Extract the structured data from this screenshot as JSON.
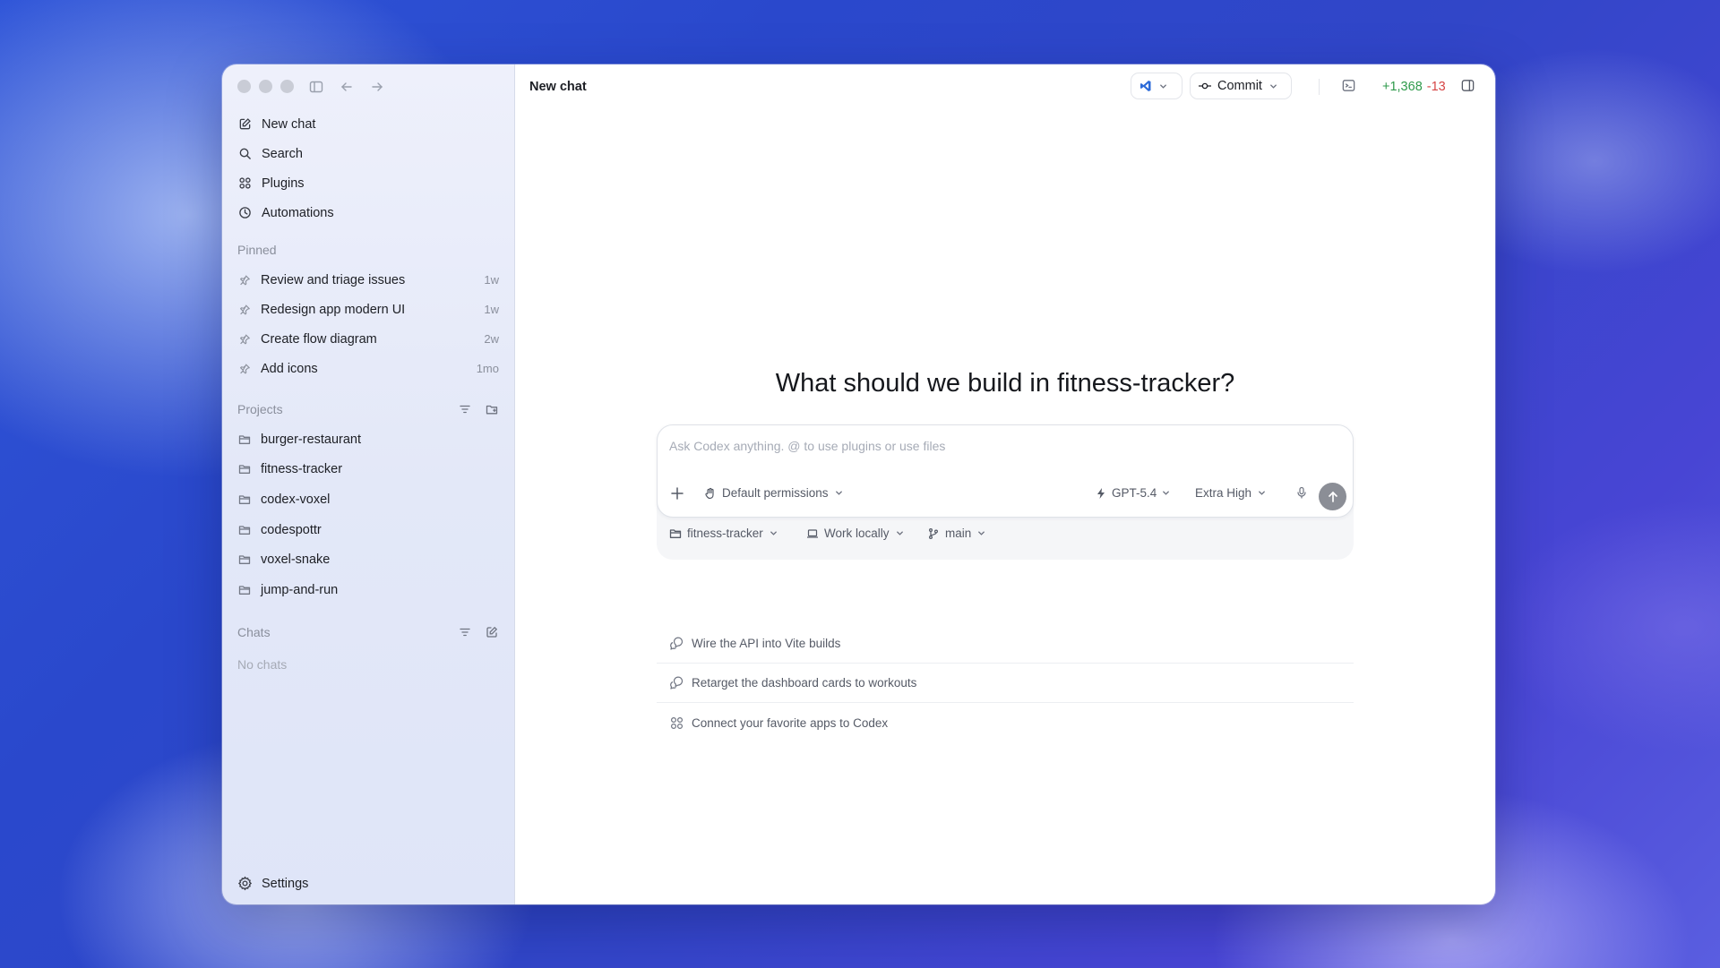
{
  "window": {
    "title": "New chat"
  },
  "sidebar": {
    "nav": [
      {
        "label": "New chat",
        "icon": "compose-icon"
      },
      {
        "label": "Search",
        "icon": "search-icon"
      },
      {
        "label": "Plugins",
        "icon": "grid-icon"
      },
      {
        "label": "Automations",
        "icon": "clock-icon"
      }
    ],
    "pinned_heading": "Pinned",
    "pinned": [
      {
        "label": "Review and triage issues",
        "time": "1w"
      },
      {
        "label": "Redesign app modern UI",
        "time": "1w"
      },
      {
        "label": "Create flow diagram",
        "time": "2w"
      },
      {
        "label": "Add icons",
        "time": "1mo"
      }
    ],
    "projects_heading": "Projects",
    "projects": [
      {
        "label": "burger-restaurant"
      },
      {
        "label": "fitness-tracker"
      },
      {
        "label": "codex-voxel"
      },
      {
        "label": "codespottr"
      },
      {
        "label": "voxel-snake"
      },
      {
        "label": "jump-and-run"
      }
    ],
    "chats_heading": "Chats",
    "no_chats": "No chats",
    "settings_label": "Settings"
  },
  "header": {
    "title": "New chat",
    "commit_label": "Commit",
    "diff_added": "+1,368",
    "diff_removed": "-13"
  },
  "main": {
    "hero": "What should we build in fitness-tracker?",
    "composer": {
      "placeholder": "Ask Codex anything. @ to use plugins or use files",
      "permissions": "Default permissions",
      "model": "GPT-5.4",
      "effort": "Extra High"
    },
    "context": {
      "project": "fitness-tracker",
      "location": "Work locally",
      "branch": "main"
    },
    "suggestions": [
      {
        "label": "Wire the API into Vite builds",
        "icon": "chat-bubbles-icon"
      },
      {
        "label": "Retarget the dashboard cards to workouts",
        "icon": "chat-bubbles-icon"
      },
      {
        "label": "Connect your favorite apps to Codex",
        "icon": "grid-icon"
      }
    ]
  },
  "colors": {
    "diff_added": "#2e9a4b",
    "diff_removed": "#d64545",
    "accent_vscode": "#2d6bd8"
  }
}
